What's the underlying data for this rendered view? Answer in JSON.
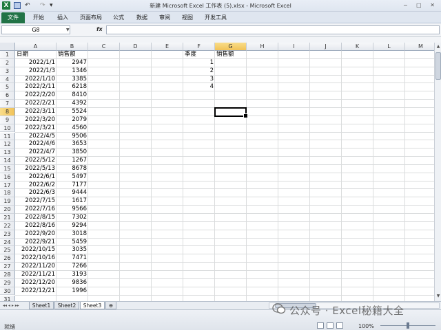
{
  "window": {
    "title": "新建 Microsoft Excel 工作表 (5).xlsx - Microsoft Excel",
    "app_icon_letter": "X",
    "window_controls": "− □ ✕"
  },
  "quick_access": {
    "undo": "↶",
    "redo": "↷",
    "more": "▾"
  },
  "ribbon_tabs": [
    "文件",
    "开始",
    "插入",
    "页面布局",
    "公式",
    "数据",
    "审阅",
    "视图",
    "开发工具"
  ],
  "formula_bar": {
    "name_box": "G8",
    "fx_label": "fx",
    "formula": ""
  },
  "columns": [
    "A",
    "B",
    "C",
    "D",
    "E",
    "F",
    "G",
    "H",
    "I",
    "J",
    "K",
    "L",
    "M"
  ],
  "selected_column": "G",
  "selected_row": 8,
  "row_count": 32,
  "headers": {
    "A1": "日期",
    "B1": "销售额",
    "F1": "季度",
    "G1": "销售额"
  },
  "sales_rows": [
    {
      "date": "2022/1/1",
      "amount": "2947"
    },
    {
      "date": "2022/1/3",
      "amount": "1346"
    },
    {
      "date": "2022/1/10",
      "amount": "3385"
    },
    {
      "date": "2022/2/11",
      "amount": "6218"
    },
    {
      "date": "2022/2/20",
      "amount": "8410"
    },
    {
      "date": "2022/2/21",
      "amount": "4392"
    },
    {
      "date": "2022/3/11",
      "amount": "5524"
    },
    {
      "date": "2022/3/20",
      "amount": "2079"
    },
    {
      "date": "2022/3/21",
      "amount": "4560"
    },
    {
      "date": "2022/4/5",
      "amount": "9506"
    },
    {
      "date": "2022/4/6",
      "amount": "3653"
    },
    {
      "date": "2022/4/7",
      "amount": "3850"
    },
    {
      "date": "2022/5/12",
      "amount": "1267"
    },
    {
      "date": "2022/5/13",
      "amount": "8678"
    },
    {
      "date": "2022/6/1",
      "amount": "5497"
    },
    {
      "date": "2022/6/2",
      "amount": "7177"
    },
    {
      "date": "2022/6/3",
      "amount": "9444"
    },
    {
      "date": "2022/7/15",
      "amount": "1617"
    },
    {
      "date": "2022/7/16",
      "amount": "9566"
    },
    {
      "date": "2022/8/15",
      "amount": "7302"
    },
    {
      "date": "2022/8/16",
      "amount": "9294"
    },
    {
      "date": "2022/9/20",
      "amount": "3018"
    },
    {
      "date": "2022/9/21",
      "amount": "5459"
    },
    {
      "date": "2022/10/15",
      "amount": "3035"
    },
    {
      "date": "2022/10/16",
      "amount": "7471"
    },
    {
      "date": "2022/11/20",
      "amount": "7266"
    },
    {
      "date": "2022/11/21",
      "amount": "3193"
    },
    {
      "date": "2022/12/20",
      "amount": "9836"
    },
    {
      "date": "2022/12/21",
      "amount": "1996"
    }
  ],
  "quarters": [
    "1",
    "2",
    "3",
    "4"
  ],
  "sheets": [
    "Sheet1",
    "Sheet2",
    "Sheet3"
  ],
  "active_sheet": "Sheet3",
  "sheet_nav": "◂◂ ◂ ▸ ▸▸",
  "status": {
    "text": "就绪",
    "zoom": "100%"
  },
  "watermark": "公众号 · Excel秘籍大全",
  "colors": {
    "file_tab": "#217346",
    "selected_header": "#f1c257",
    "grid_line": "#dadcdd"
  }
}
